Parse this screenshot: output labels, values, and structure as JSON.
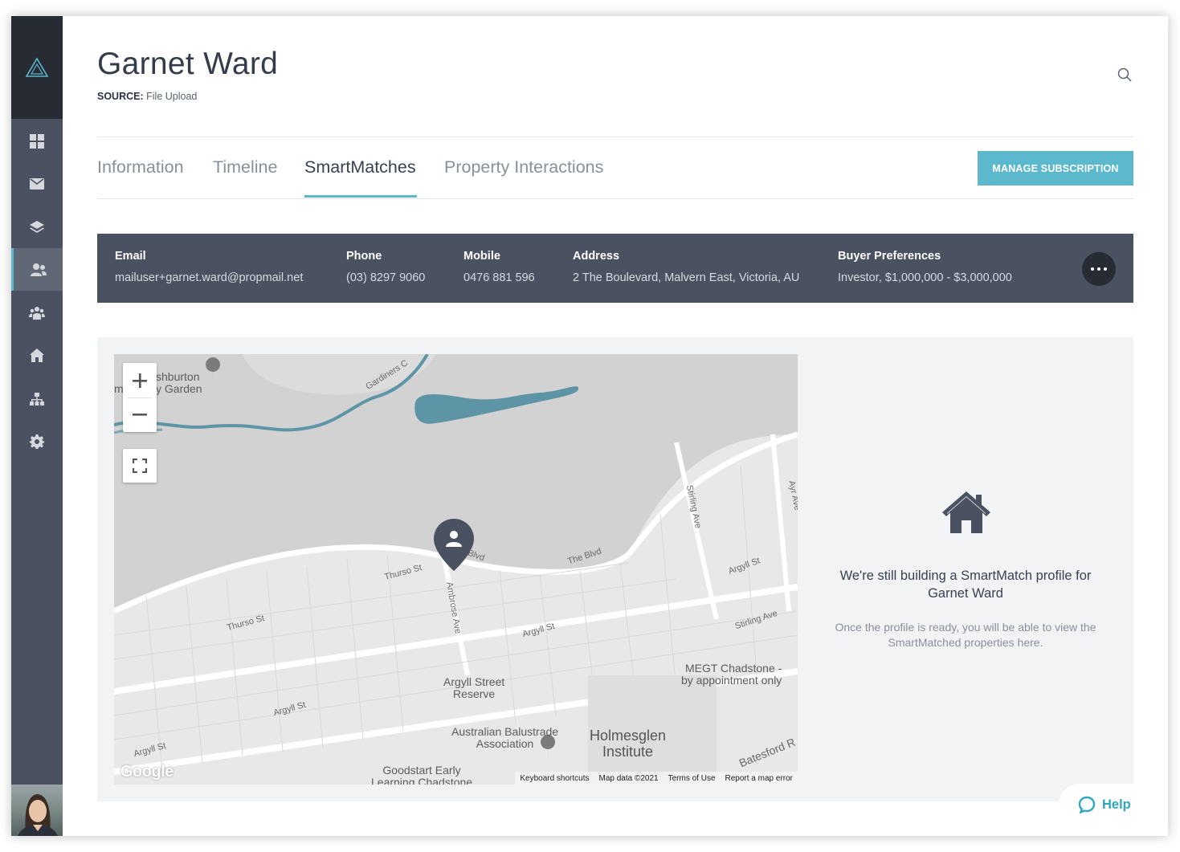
{
  "sidebar": {
    "logo_icon": "triangle-logo-icon",
    "items": [
      {
        "icon": "dashboard-icon",
        "active": false
      },
      {
        "icon": "mail-icon",
        "active": false
      },
      {
        "icon": "layers-icon",
        "active": false
      },
      {
        "icon": "contacts-icon",
        "active": true
      },
      {
        "icon": "groups-icon",
        "active": false
      },
      {
        "icon": "home-icon",
        "active": false
      },
      {
        "icon": "sitemap-icon",
        "active": false
      },
      {
        "icon": "gear-icon",
        "active": false
      }
    ],
    "avatar": "user-avatar"
  },
  "header": {
    "title": "Garnet Ward",
    "source_label": "SOURCE:",
    "source_value": "File Upload"
  },
  "tabs": [
    {
      "label": "Information",
      "active": false
    },
    {
      "label": "Timeline",
      "active": false
    },
    {
      "label": "SmartMatches",
      "active": true
    },
    {
      "label": "Property Interactions",
      "active": false
    }
  ],
  "manage_button": "MANAGE SUBSCRIPTION",
  "contact": {
    "email": {
      "label": "Email",
      "value": "mailuser+garnet.ward@propmail.net"
    },
    "phone": {
      "label": "Phone",
      "value": "(03) 8297 9060"
    },
    "mobile": {
      "label": "Mobile",
      "value": "0476 881 596"
    },
    "address": {
      "label": "Address",
      "value": "2 The Boulevard, Malvern East, Victoria, AU"
    },
    "preferences": {
      "label": "Buyer Preferences",
      "value": "Investor, $1,000,000 - $3,000,000"
    }
  },
  "map": {
    "labels": {
      "garden": "shburton\ny Garden",
      "garden_prefix": "m",
      "argyll_reserve": "Argyll Street\nReserve",
      "megt": "MEGT Chadstone -\nby appointment only",
      "balustrade": "Australian Balustrade\nAssociation",
      "holmesglen": "Holmesglen\nInstitute",
      "goodstart": "Goodstart Early\nLearning Chadstone"
    },
    "streets": {
      "thurso1": "Thurso St",
      "thurso2": "Thurso St",
      "ambrose": "Ambrose Ave",
      "blvd1": "Blvd",
      "blvd2": "The Blvd",
      "argyll1": "Argyll St",
      "argyll2": "Argyll St",
      "argyll3": "Argyll St",
      "argyll4": "Argyll St",
      "stirling1": "Stirling Ave",
      "stirling2": "Stirling Ave",
      "ayr": "Ayr Ave",
      "batesford": "Batesford R",
      "gardiners": "Gardiners C"
    },
    "logo": "Google",
    "footer": [
      "Keyboard shortcuts",
      "Map data ©2021",
      "Terms of Use",
      "Report a map error"
    ]
  },
  "empty_state": {
    "icon": "house-icon",
    "title": "We're still building a SmartMatch profile for Garnet Ward",
    "subtitle": "Once the profile is ready, you will be able to view the SmartMatched properties here."
  },
  "help": {
    "icon": "chat-bubble-icon",
    "label": "Help"
  },
  "colors": {
    "accent": "#5bb8cd",
    "sidebar": "#4a5160",
    "bar": "#4a5261",
    "water": "#5e95a6"
  }
}
